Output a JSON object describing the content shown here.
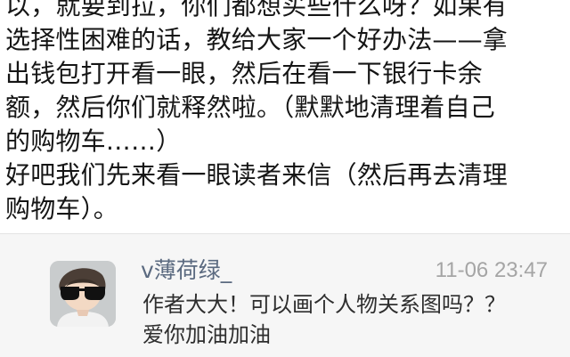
{
  "article": {
    "lines": [
      "以，就要到拉，你们都想买些什么呀？如果有",
      "选择性困难的话，教给大家一个好办法——拿",
      "出钱包打开看一眼，然后在看一下银行卡余",
      "额，然后你们就释然啦。（默默地清理着自己",
      "的购物车……）",
      "好吧我们先来看一眼读者来信（然后再去清理",
      "购物车）。"
    ]
  },
  "comment": {
    "username": "v薄荷绿_",
    "timestamp": "11-06 23:47",
    "lines": [
      "作者大大！可以画个人物关系图吗？？",
      "爱你加油加油"
    ],
    "avatar_icon": "person-avatar-icon"
  }
}
